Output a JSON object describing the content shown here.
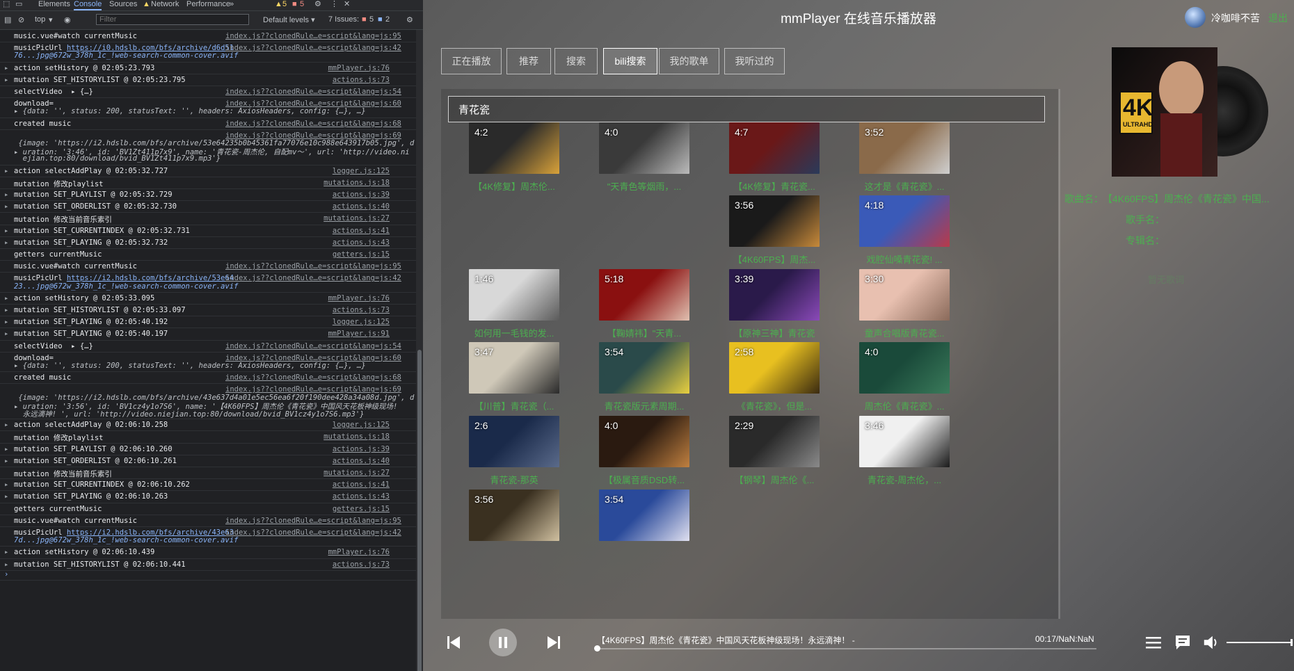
{
  "devtools": {
    "tabs": [
      "Elements",
      "Console",
      "Sources",
      "Network",
      "Performance"
    ],
    "active_tab": "Console",
    "more": "»",
    "warnings": "5",
    "errors": "5",
    "context": "top",
    "filter_placeholder": "Filter",
    "levels": "Default levels ▾",
    "issues_label": "7 Issues:",
    "issues_errors": "5",
    "issues_info": "2",
    "log": [
      {
        "m": "music.vue#watch currentMusic",
        "s": "index.js??clonedRule…e=script&lang=js:95",
        "h": 1
      },
      {
        "m": "musicPicUrl https://i0.hdslb.com/bfs/archive/d6d51",
        "m2": "76...jpg@672w_378h_1c_!web-search-common-cover.avif",
        "s": "index.js??clonedRule…e=script&lang=js:42",
        "h": 2
      },
      {
        "a": "▸",
        "m": "action setHistory @ 02:05:23.793",
        "s": "mmPlayer.js:76",
        "h": 1
      },
      {
        "a": "▸",
        "m": "mutation SET_HISTORYLIST @ 02:05:23.795",
        "s": "actions.js:73",
        "h": 1
      },
      {
        "m": "selectVideo  ▸ {…}",
        "s": "index.js??clonedRule…e=script&lang=js:54",
        "h": 1
      },
      {
        "m": "download=",
        "m2": "▸ {data: '', status: 200, statusText: '', headers: AxiosHeaders, config: {…}, …}",
        "s": "index.js??clonedRule…e=script&lang=js:60",
        "h": 2
      },
      {
        "m": "created music",
        "s": "index.js??clonedRule…e=script&lang=js:68",
        "h": 1
      },
      {
        "m": "",
        "m2": " {image: 'https://i2.hdslb.com/bfs/archive/53e64235b0b45361fa77076e10c988e643917b05.jpg', d",
        "m3": "▸ uration: '3:46', id: 'BV1Zt411p7x9', name: '青花瓷-周杰伦, 自配mv～', url: 'http://video.ni",
        "m4": "  ejian.top:80/download/bvid_BV1Zt411p7x9.mp3'}",
        "s": "index.js??clonedRule…e=script&lang=js:69",
        "h": 4
      },
      {
        "a": "▸",
        "m": "action selectAddPlay @ 02:05:32.727",
        "s": "logger.js:125",
        "h": 1
      },
      {
        "m": "mutation 修改playlist",
        "s": "mutations.js:18",
        "h": 1
      },
      {
        "a": "▸",
        "m": "mutation SET_PLAYLIST @ 02:05:32.729",
        "s": "actions.js:39",
        "h": 1
      },
      {
        "a": "▸",
        "m": "mutation SET_ORDERLIST @ 02:05:32.730",
        "s": "actions.js:40",
        "h": 1
      },
      {
        "m": "mutation 修改当前音乐索引",
        "s": "mutations.js:27",
        "h": 1
      },
      {
        "a": "▸",
        "m": "mutation SET_CURRENTINDEX @ 02:05:32.731",
        "s": "actions.js:41",
        "h": 1
      },
      {
        "a": "▸",
        "m": "mutation SET_PLAYING @ 02:05:32.732",
        "s": "actions.js:43",
        "h": 1
      },
      {
        "m": "getters currentMusic",
        "s": "getters.js:15",
        "h": 1
      },
      {
        "m": "music.vue#watch currentMusic",
        "s": "index.js??clonedRule…e=script&lang=js:95",
        "h": 1
      },
      {
        "m": "musicPicUrl https://i2.hdslb.com/bfs/archive/53e64",
        "m2": "23...jpg@672w_378h_1c_!web-search-common-cover.avif",
        "s": "index.js??clonedRule…e=script&lang=js:42",
        "h": 2
      },
      {
        "a": "▸",
        "m": "action setHistory @ 02:05:33.095",
        "s": "mmPlayer.js:76",
        "h": 1
      },
      {
        "a": "▸",
        "m": "mutation SET_HISTORYLIST @ 02:05:33.097",
        "s": "actions.js:73",
        "h": 1
      },
      {
        "a": "▸",
        "m": "mutation SET_PLAYING @ 02:05:40.192",
        "s": "logger.js:125",
        "h": 1
      },
      {
        "a": "▸",
        "m": "mutation SET_PLAYING @ 02:05:40.197",
        "s": "mmPlayer.js:91",
        "h": 1
      },
      {
        "m": "selectVideo  ▸ {…}",
        "s": "index.js??clonedRule…e=script&lang=js:54",
        "h": 1
      },
      {
        "m": "download=",
        "m2": "▸ {data: '', status: 200, statusText: '', headers: AxiosHeaders, config: {…}, …}",
        "s": "index.js??clonedRule…e=script&lang=js:60",
        "h": 2
      },
      {
        "m": "created music",
        "s": "index.js??clonedRule…e=script&lang=js:68",
        "h": 1
      },
      {
        "m": "",
        "m2": " {image: 'https://i2.hdslb.com/bfs/archive/43e637d4a01e5ec56ea6f20f190dee428a34a08d.jpg', d",
        "m3": "▸ uration: '3:56', id: 'BV1cz4y1o7S6', name: '【4K60FPS】周杰伦《青花瓷》中国风天花板神级现场!",
        "m4": "  永远滴神! ', url: 'http://video.niejian.top:80/download/bvid_BV1cz4y1o7S6.mp3'}",
        "s": "index.js??clonedRule…e=script&lang=js:69",
        "h": 4
      },
      {
        "a": "▸",
        "m": "action selectAddPlay @ 02:06:10.258",
        "s": "logger.js:125",
        "h": 1
      },
      {
        "m": "mutation 修改playlist",
        "s": "mutations.js:18",
        "h": 1
      },
      {
        "a": "▸",
        "m": "mutation SET_PLAYLIST @ 02:06:10.260",
        "s": "actions.js:39",
        "h": 1
      },
      {
        "a": "▸",
        "m": "mutation SET_ORDERLIST @ 02:06:10.261",
        "s": "actions.js:40",
        "h": 1
      },
      {
        "m": "mutation 修改当前音乐索引",
        "s": "mutations.js:27",
        "h": 1
      },
      {
        "a": "▸",
        "m": "mutation SET_CURRENTINDEX @ 02:06:10.262",
        "s": "actions.js:41",
        "h": 1
      },
      {
        "a": "▸",
        "m": "mutation SET_PLAYING @ 02:06:10.263",
        "s": "actions.js:43",
        "h": 1
      },
      {
        "m": "getters currentMusic",
        "s": "getters.js:15",
        "h": 1
      },
      {
        "m": "music.vue#watch currentMusic",
        "s": "index.js??clonedRule…e=script&lang=js:95",
        "h": 1
      },
      {
        "m": "musicPicUrl https://i2.hdslb.com/bfs/archive/43e63",
        "m2": "7d...jpg@672w_378h_1c_!web-search-common-cover.avif",
        "s": "index.js??clonedRule…e=script&lang=js:42",
        "h": 2
      },
      {
        "a": "▸",
        "m": "action setHistory @ 02:06:10.439",
        "s": "mmPlayer.js:76",
        "h": 1
      },
      {
        "a": "▸",
        "m": "mutation SET_HISTORYLIST @ 02:06:10.441",
        "s": "actions.js:73",
        "h": 1
      }
    ],
    "prompt": "›"
  },
  "app": {
    "title": "mmPlayer 在线音乐播放器",
    "username": "冷咖啡不苦",
    "logout": "退出",
    "tabs": [
      {
        "label": "正在播放",
        "active": false
      },
      {
        "label": "推荐",
        "active": false
      },
      {
        "label": "搜索",
        "active": false
      },
      {
        "label": "bili搜索",
        "active": true
      },
      {
        "label": "我的歌单",
        "active": false
      },
      {
        "label": "我听过的",
        "active": false
      }
    ],
    "search_value": "青花瓷",
    "videos": [
      {
        "duration": "4:2",
        "title": "【4K修复】周杰伦...",
        "colors": [
          "#2a2a2a",
          "#d9a23a"
        ]
      },
      {
        "duration": "4:0",
        "title": "\"天青色等烟雨，...",
        "colors": [
          "#3a3a3a",
          "#bbbbbb"
        ]
      },
      {
        "duration": "4:7",
        "title": "【4K修复】青花瓷...",
        "colors": [
          "#6a1818",
          "#2a3a5a"
        ]
      },
      {
        "duration": "3:52",
        "title": "这才是《青花瓷》...",
        "colors": [
          "#8a6a4a",
          "#cfcfcf"
        ]
      },
      {
        "duration": "3:56",
        "title": "【4K60FPS】周杰...",
        "colors": [
          "#1a1a1a",
          "#c88a3a"
        ]
      },
      {
        "duration": "4:18",
        "title": "戏腔仙嗓青花瓷! ...",
        "colors": [
          "#3a5ab8",
          "#b83a4a"
        ]
      },
      {
        "duration": "1:46",
        "title": "如何用一毛钱的发...",
        "colors": [
          "#d8d8d8",
          "#5a5a5a"
        ]
      },
      {
        "duration": "5:18",
        "title": "【鞠婧祎】\"天青...",
        "colors": [
          "#8a1010",
          "#e0c0b0"
        ]
      },
      {
        "duration": "3:39",
        "title": "【原神三神】青花瓷",
        "colors": [
          "#2a1a4a",
          "#8a4ab8"
        ]
      },
      {
        "duration": "3:30",
        "title": "童声合唱版青花瓷...",
        "colors": [
          "#e8c0b0",
          "#8a6a5a"
        ]
      },
      {
        "duration": "3:47",
        "title": "【川普】青花瓷（...",
        "colors": [
          "#cfc8b8",
          "#2a2a2a"
        ]
      },
      {
        "duration": "3:54",
        "title": "青花瓷版元素周期...",
        "colors": [
          "#2a4a4a",
          "#e8d040"
        ]
      },
      {
        "duration": "2:58",
        "title": "《青花瓷》，但是...",
        "colors": [
          "#e8c020",
          "#3a2a10"
        ]
      },
      {
        "duration": "4:0",
        "title": "周杰伦《青花瓷》...",
        "colors": [
          "#1a4a3a",
          "#3a7a5a"
        ]
      },
      {
        "duration": "2:6",
        "title": "青花瓷-那英",
        "colors": [
          "#1a2a4a",
          "#5a6a8a"
        ]
      },
      {
        "duration": "4:0",
        "title": "【极属音质DSD转...",
        "colors": [
          "#2a1a10",
          "#c08040"
        ]
      },
      {
        "duration": "2:29",
        "title": "【钢琴】周杰伦《...",
        "colors": [
          "#2a2a2a",
          "#8a8a8a"
        ]
      },
      {
        "duration": "3:46",
        "title": "青花瓷-周杰伦，...",
        "colors": [
          "#f0f0f0",
          "#1a1a1a"
        ]
      },
      {
        "duration": "3:56",
        "title": "",
        "colors": [
          "#3a3020",
          "#d0c0a0"
        ]
      },
      {
        "duration": "3:54",
        "title": "",
        "colors": [
          "#2a4a9a",
          "#e0e0f0"
        ]
      }
    ],
    "cover_badge": "4K",
    "cover_sub": "ULTRAHD",
    "song_label": "歌曲名：",
    "song_name": "【4K60FPS】周杰伦《青花瓷》中国...",
    "artist_label": "歌手名：",
    "album_label": "专辑名：",
    "lyric_hint": "暂无歌词",
    "player": {
      "now_playing": "【4K60FPS】周杰伦《青花瓷》中国风天花板神级现场！永远滴神！  -",
      "time": "00:17/NaN:NaN",
      "progress": 0.0,
      "volume": 1.0
    },
    "colors": {
      "accent": "#4caf50"
    }
  }
}
